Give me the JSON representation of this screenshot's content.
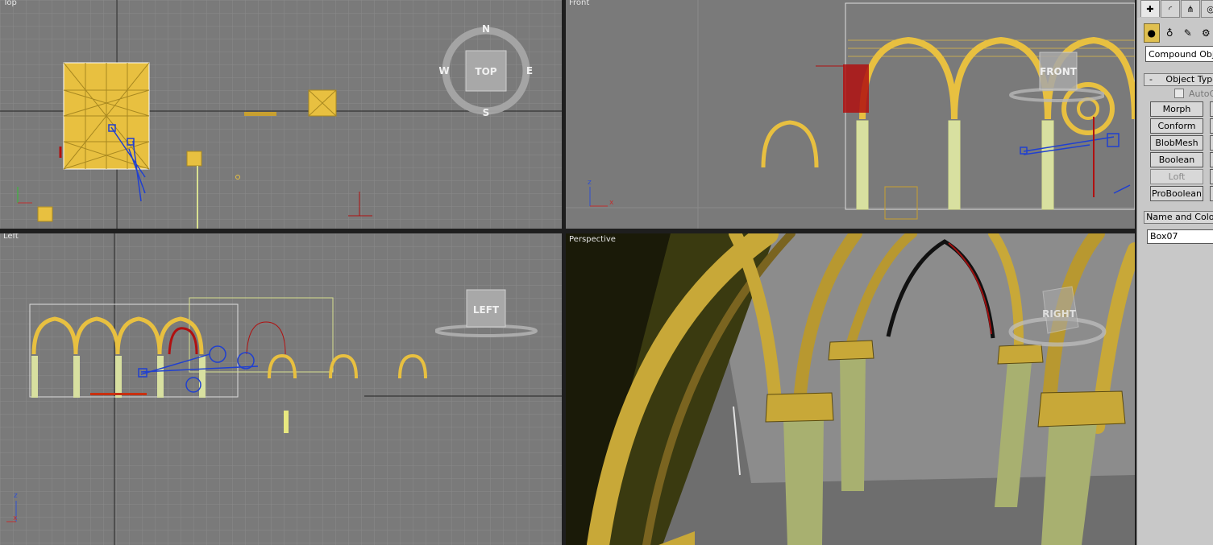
{
  "viewports": {
    "top": {
      "label": "Top",
      "cube_label": "TOP",
      "compass": {
        "n": "N",
        "w": "W",
        "e": "E",
        "s": "S"
      }
    },
    "front": {
      "label": "Front",
      "cube_label": "FRONT"
    },
    "left": {
      "label": "Left",
      "cube_label": "LEFT"
    },
    "perspective": {
      "label": "Perspective",
      "cube_label": "RIGHT"
    }
  },
  "axis": {
    "x": "x",
    "y": "y",
    "z": "z"
  },
  "command_panel": {
    "tabs": [
      "create-icon",
      "modify-icon",
      "hierarchy-icon",
      "motion-icon"
    ],
    "category_icons": [
      "geometry-icon",
      "shapes-icon",
      "lights-icon",
      "cameras-icon"
    ],
    "dropdown_value": "Compound Objects",
    "object_type": {
      "title": "Object Type",
      "autogrid_label": "AutoGrid",
      "buttons": [
        {
          "label": "Morph",
          "enabled": true
        },
        {
          "label": "Conform",
          "enabled": true
        },
        {
          "label": "BlobMesh",
          "enabled": true
        },
        {
          "label": "Boolean",
          "enabled": true
        },
        {
          "label": "Loft",
          "enabled": false
        },
        {
          "label": "ProBoolean",
          "enabled": true
        }
      ]
    },
    "name_color": {
      "title": "Name and Color",
      "name_value": "Box07"
    }
  },
  "colors": {
    "selected_border": "#e0e060",
    "object_gold": "#e8c040",
    "helper_blue": "#2040d0",
    "accent_red": "#b01010"
  }
}
